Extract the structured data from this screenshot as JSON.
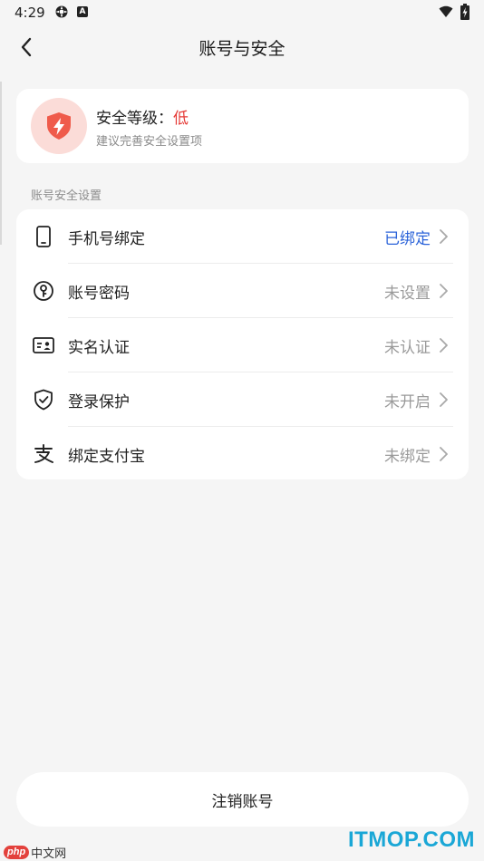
{
  "status_bar": {
    "time": "4:29",
    "a_badge": "A"
  },
  "header": {
    "title": "账号与安全"
  },
  "security_card": {
    "level_prefix": "安全等级：",
    "level_value": "低",
    "hint": "建议完善安全设置项",
    "accent_color": "#e53935"
  },
  "section_label": "账号安全设置",
  "settings": [
    {
      "label": "手机号绑定",
      "value": "已绑定",
      "icon": "phone-icon"
    },
    {
      "label": "账号密码",
      "value": "未设置",
      "icon": "key-icon"
    },
    {
      "label": "实名认证",
      "value": "未认证",
      "icon": "id-card-icon"
    },
    {
      "label": "登录保护",
      "value": "未开启",
      "icon": "shield-check-icon"
    },
    {
      "label": "绑定支付宝",
      "value": "未绑定",
      "icon": "alipay-icon"
    }
  ],
  "cancel_account_label": "注销账号",
  "watermarks": {
    "itmop": "ITMOP.COM",
    "php_logo": "php",
    "php_text": "中文网"
  },
  "colors": {
    "link_blue": "#2b63d9",
    "muted": "#9a9a9a",
    "background": "#f5f5f5"
  }
}
